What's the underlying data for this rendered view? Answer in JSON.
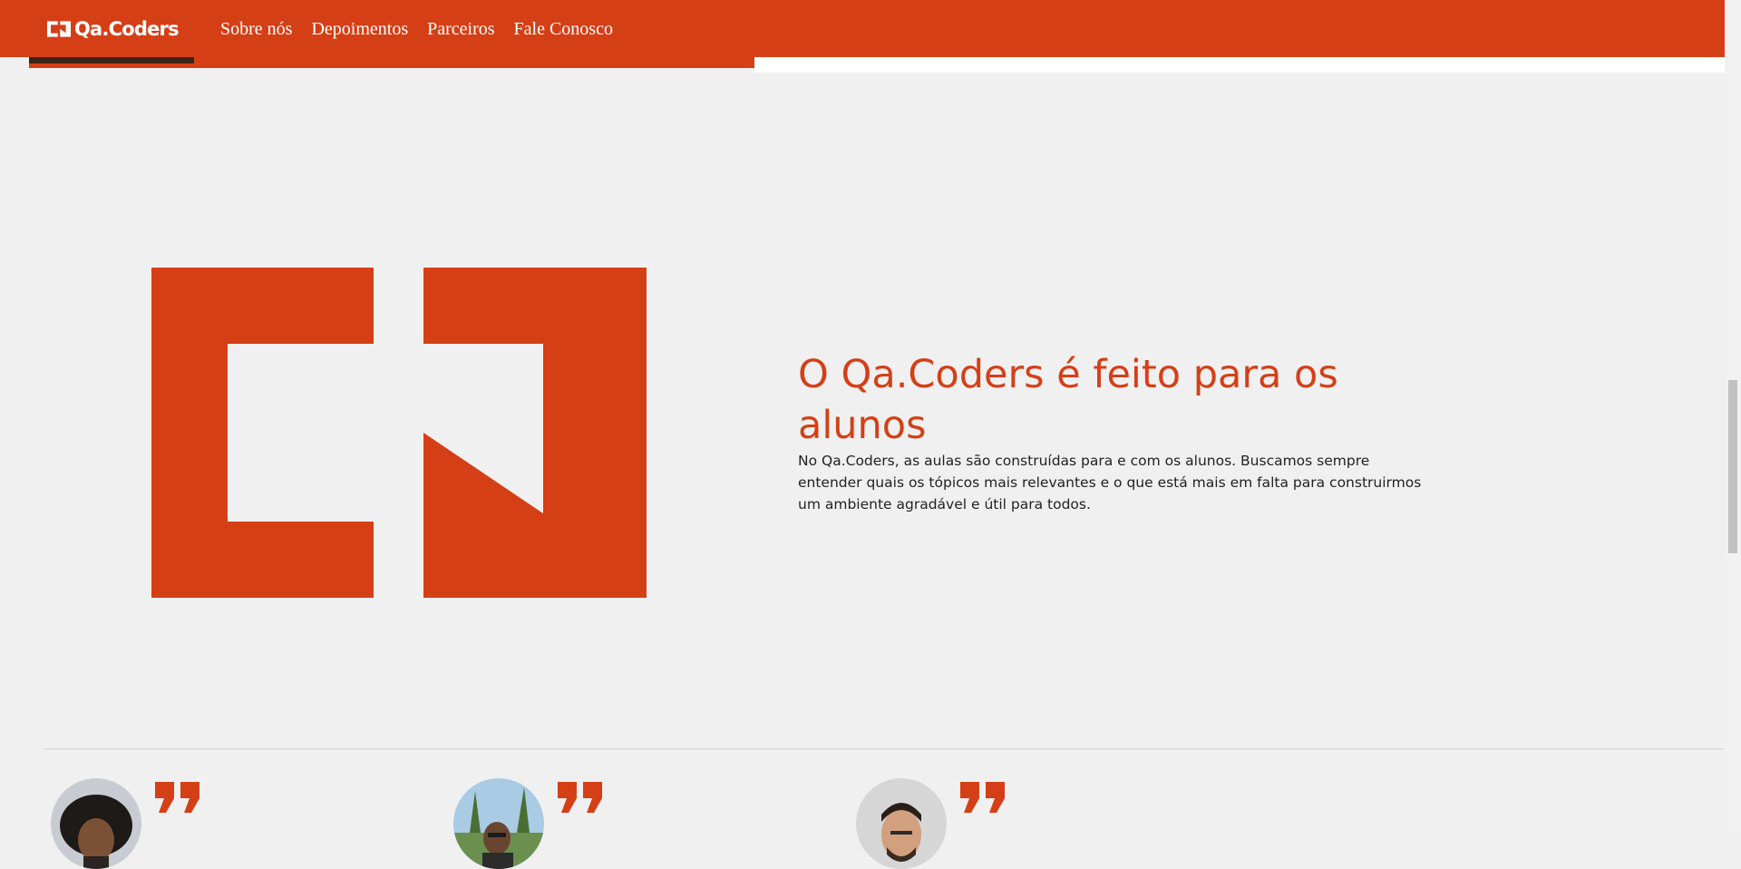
{
  "nav": {
    "logo_text": "Qa.Coders",
    "links": [
      "Sobre nós",
      "Depoimentos",
      "Parceiros",
      "Fale Conosco"
    ]
  },
  "about": {
    "title": "O Qa.Coders é feito para os alunos",
    "description": "No Qa.Coders, as aulas são construídas para e com os alunos. Buscamos sempre entender quais os tópicos mais relevantes e o que está mais em falta para construirmos um ambiente agradável e útil para todos."
  },
  "testimonials": [
    {
      "avatar": "student-avatar-1",
      "quote_icon": "quote-icon"
    },
    {
      "avatar": "student-avatar-2",
      "quote_icon": "quote-icon"
    },
    {
      "avatar": "student-avatar-3",
      "quote_icon": "quote-icon"
    }
  ],
  "colors": {
    "brand": "#d53f16",
    "background": "#f0f0f0",
    "text": "#222222"
  }
}
